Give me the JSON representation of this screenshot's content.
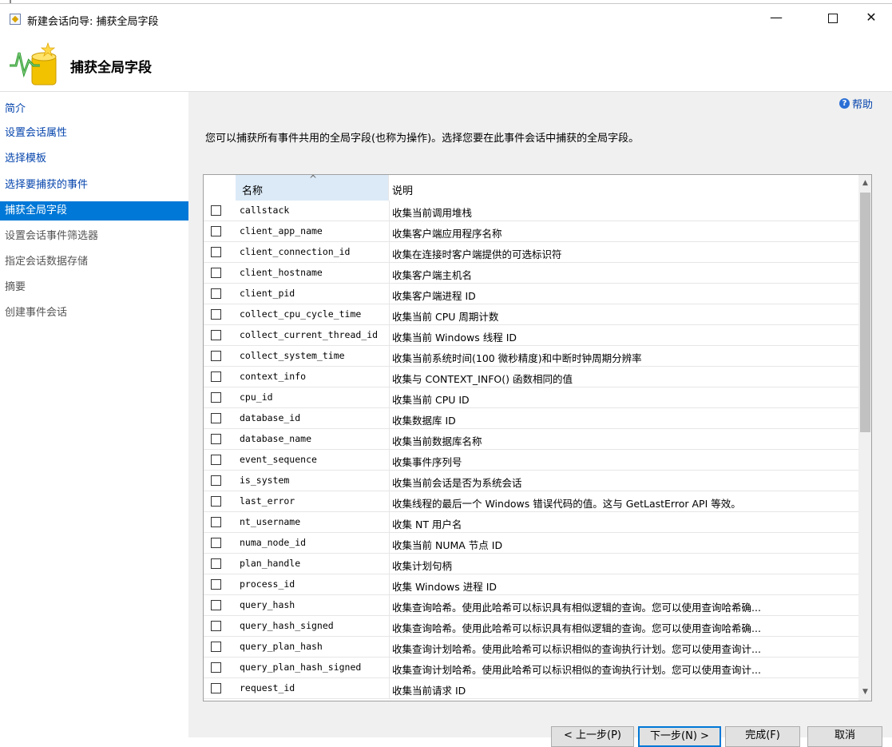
{
  "window": {
    "title": "新建会话向导: 捕获全局字段",
    "minimize_glyph": "—",
    "close_glyph": "✕"
  },
  "header": {
    "title": "捕获全局字段",
    "icon": "wizard-chart-database-icon"
  },
  "nav": {
    "items": [
      {
        "label": "简介",
        "state": "link"
      },
      {
        "label": "设置会话属性",
        "state": "link"
      },
      {
        "label": "选择模板",
        "state": "link"
      },
      {
        "label": "选择要捕获的事件",
        "state": "link"
      },
      {
        "label": "捕获全局字段",
        "state": "active"
      },
      {
        "label": "设置会话事件筛选器",
        "state": "muted"
      },
      {
        "label": "指定会话数据存储",
        "state": "muted"
      },
      {
        "label": "摘要",
        "state": "muted"
      },
      {
        "label": "创建事件会话",
        "state": "muted"
      }
    ]
  },
  "help": {
    "label": "帮助",
    "icon_glyph": "?"
  },
  "description": "您可以捕获所有事件共用的全局字段(也称为操作)。选择您要在此事件会话中捕获的全局字段。",
  "grid": {
    "columns": {
      "name": "名称",
      "description": "说明"
    },
    "sort_glyph": "^",
    "rows": [
      {
        "name": "callstack",
        "desc": "收集当前调用堆栈",
        "checked": false
      },
      {
        "name": "client_app_name",
        "desc": "收集客户端应用程序名称",
        "checked": false
      },
      {
        "name": "client_connection_id",
        "desc": "收集在连接时客户端提供的可选标识符",
        "checked": false
      },
      {
        "name": "client_hostname",
        "desc": "收集客户端主机名",
        "checked": false
      },
      {
        "name": "client_pid",
        "desc": "收集客户端进程 ID",
        "checked": false
      },
      {
        "name": "collect_cpu_cycle_time",
        "desc": "收集当前 CPU 周期计数",
        "checked": false
      },
      {
        "name": "collect_current_thread_id",
        "desc": "收集当前 Windows 线程 ID",
        "checked": false
      },
      {
        "name": "collect_system_time",
        "desc": "收集当前系统时间(100 微秒精度)和中断时钟周期分辨率",
        "checked": false
      },
      {
        "name": "context_info",
        "desc": "收集与 CONTEXT_INFO() 函数相同的值",
        "checked": false
      },
      {
        "name": "cpu_id",
        "desc": "收集当前 CPU ID",
        "checked": false
      },
      {
        "name": "database_id",
        "desc": "收集数据库 ID",
        "checked": false
      },
      {
        "name": "database_name",
        "desc": "收集当前数据库名称",
        "checked": false
      },
      {
        "name": "event_sequence",
        "desc": "收集事件序列号",
        "checked": false
      },
      {
        "name": "is_system",
        "desc": "收集当前会话是否为系统会话",
        "checked": false
      },
      {
        "name": "last_error",
        "desc": "收集线程的最后一个 Windows 错误代码的值。这与 GetLastError API 等效。",
        "checked": false
      },
      {
        "name": "nt_username",
        "desc": "收集 NT 用户名",
        "checked": false
      },
      {
        "name": "numa_node_id",
        "desc": "收集当前 NUMA 节点 ID",
        "checked": false
      },
      {
        "name": "plan_handle",
        "desc": "收集计划句柄",
        "checked": false
      },
      {
        "name": "process_id",
        "desc": "收集 Windows 进程 ID",
        "checked": false
      },
      {
        "name": "query_hash",
        "desc": "收集查询哈希。使用此哈希可以标识具有相似逻辑的查询。您可以使用查询哈希确...",
        "checked": false
      },
      {
        "name": "query_hash_signed",
        "desc": "收集查询哈希。使用此哈希可以标识具有相似逻辑的查询。您可以使用查询哈希确...",
        "checked": false
      },
      {
        "name": "query_plan_hash",
        "desc": "收集查询计划哈希。使用此哈希可以标识相似的查询执行计划。您可以使用查询计...",
        "checked": false
      },
      {
        "name": "query_plan_hash_signed",
        "desc": "收集查询计划哈希。使用此哈希可以标识相似的查询执行计划。您可以使用查询计...",
        "checked": false
      },
      {
        "name": "request_id",
        "desc": "收集当前请求 ID",
        "checked": false
      }
    ],
    "scroll_up_glyph": "▲",
    "scroll_down_glyph": "▼"
  },
  "buttons": {
    "back": "< 上一步(P)",
    "next": "下一步(N) >",
    "finish": "完成(F)",
    "cancel": "取消"
  },
  "colors": {
    "accent": "#0078d7",
    "link": "#0645ad",
    "panel": "#f0f0f0"
  }
}
